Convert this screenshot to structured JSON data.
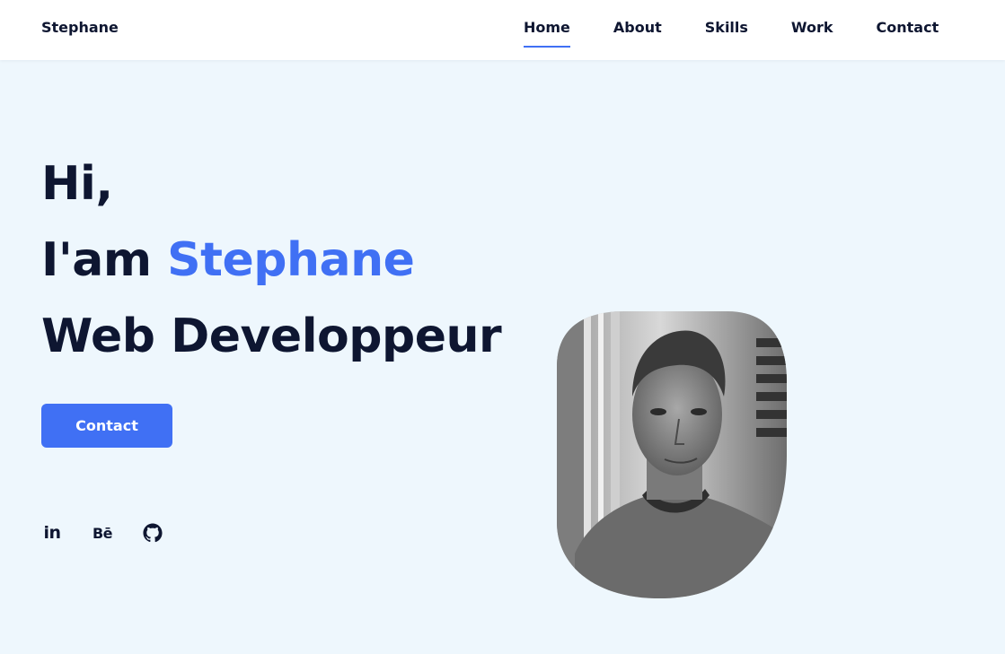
{
  "header": {
    "logo": "Stephane",
    "nav": [
      {
        "label": "Home",
        "active": true
      },
      {
        "label": "About",
        "active": false
      },
      {
        "label": "Skills",
        "active": false
      },
      {
        "label": "Work",
        "active": false
      },
      {
        "label": "Contact",
        "active": false
      }
    ]
  },
  "hero": {
    "greeting": "Hi,",
    "intro_prefix": "I'am ",
    "name": "Stephane",
    "role": "Web Developpeur",
    "cta_label": "Contact"
  },
  "social": [
    {
      "label": "in",
      "icon": "linkedin-icon"
    },
    {
      "label": "Bē",
      "icon": "behance-icon"
    },
    {
      "label": "",
      "icon": "github-icon"
    }
  ],
  "colors": {
    "accent": "#4070f4",
    "text": "#0e1631",
    "background": "#eef7fd",
    "header_bg": "#ffffff"
  }
}
